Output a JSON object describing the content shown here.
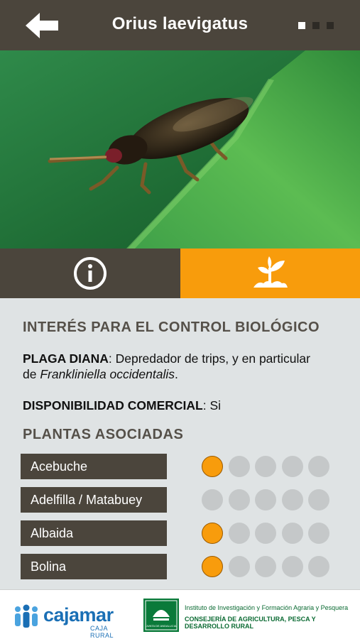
{
  "header": {
    "title": "Orius laevigatus",
    "back_icon": "arrow-left-icon",
    "pager": {
      "count": 3,
      "active": 1
    }
  },
  "tabs": [
    {
      "icon": "info-icon",
      "active": false
    },
    {
      "icon": "seedling-icon",
      "active": true
    }
  ],
  "content": {
    "section_title": "INTERÉS PARA EL CONTROL BIOLÓGICO",
    "plaga": {
      "label": "PLAGA DIANA",
      "text1": ": Depredador de trips, y en particular",
      "text2_prefix": "de ",
      "species": "Frankliniella occidentalis",
      "text2_suffix": "."
    },
    "disponibilidad": {
      "label": "DISPONIBILIDAD COMERCIAL",
      "value": ": Si"
    },
    "plantas_title": "PLANTAS ASOCIADAS",
    "plantas": [
      {
        "name": "Acebuche",
        "rating": 1,
        "max": 5
      },
      {
        "name": "Adelfilla / Matabuey",
        "rating": 0,
        "max": 5
      },
      {
        "name": "Albaida",
        "rating": 1,
        "max": 5
      },
      {
        "name": "Bolina",
        "rating": 1,
        "max": 5
      }
    ]
  },
  "footer": {
    "cajamar_name": "cajamar",
    "cajamar_sub": "CAJA RURAL",
    "junta_text": "JUNTA DE ANDALUCIA",
    "institute_line1": "Instituto de Investigación y Formación Agraria y Pesquera",
    "institute_line2": "CONSEJERÍA DE AGRICULTURA, PESCA Y DESARROLLO RURAL"
  },
  "colors": {
    "header": "#4b453c",
    "accent": "#f89c0c",
    "background": "#dfe3e4",
    "inactive_circle": "#c5c8c9"
  }
}
